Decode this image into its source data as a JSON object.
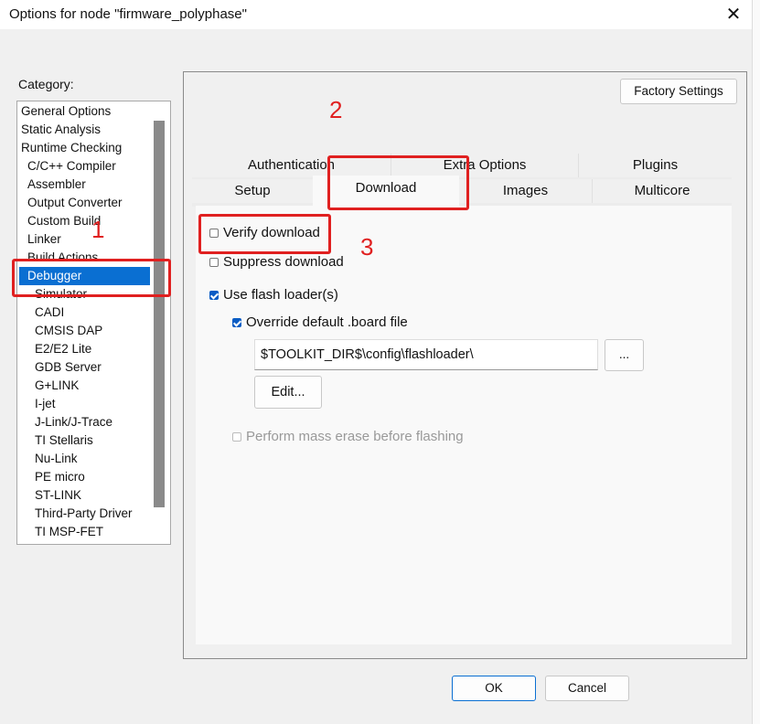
{
  "window": {
    "title": "Options for node \"firmware_polyphase\""
  },
  "category": {
    "label": "Category:",
    "items": [
      "General Options",
      "Static Analysis",
      "Runtime Checking",
      "C/C++ Compiler",
      "Assembler",
      "Output Converter",
      "Custom Build",
      "Linker",
      "Build Actions",
      "Debugger",
      "Simulator",
      "CADI",
      "CMSIS DAP",
      "E2/E2 Lite",
      "GDB Server",
      "G+LINK",
      "I-jet",
      "J-Link/J-Trace",
      "TI Stellaris",
      "Nu-Link",
      "PE micro",
      "ST-LINK",
      "Third-Party Driver",
      "TI MSP-FET"
    ],
    "selected": "Debugger"
  },
  "factory_settings": "Factory Settings",
  "tabs": {
    "row1": [
      "Authentication",
      "Extra Options",
      "Plugins"
    ],
    "row2": [
      "Setup",
      "Download",
      "Images",
      "Multicore"
    ],
    "active": "Download"
  },
  "download": {
    "verify": {
      "label": "Verify download",
      "checked": false
    },
    "suppress": {
      "label": "Suppress download",
      "checked": false
    },
    "flash_loader": {
      "label": "Use flash loader(s)",
      "checked": true
    },
    "override": {
      "label": "Override default .board file",
      "checked": true
    },
    "board_path": "$TOOLKIT_DIR$\\config\\flashloader\\",
    "browse": "...",
    "edit": "Edit...",
    "mass_erase": {
      "label": "Perform mass erase before flashing",
      "checked": false,
      "enabled": false
    }
  },
  "buttons": {
    "ok": "OK",
    "cancel": "Cancel"
  },
  "annotations": [
    "1",
    "2",
    "3"
  ]
}
